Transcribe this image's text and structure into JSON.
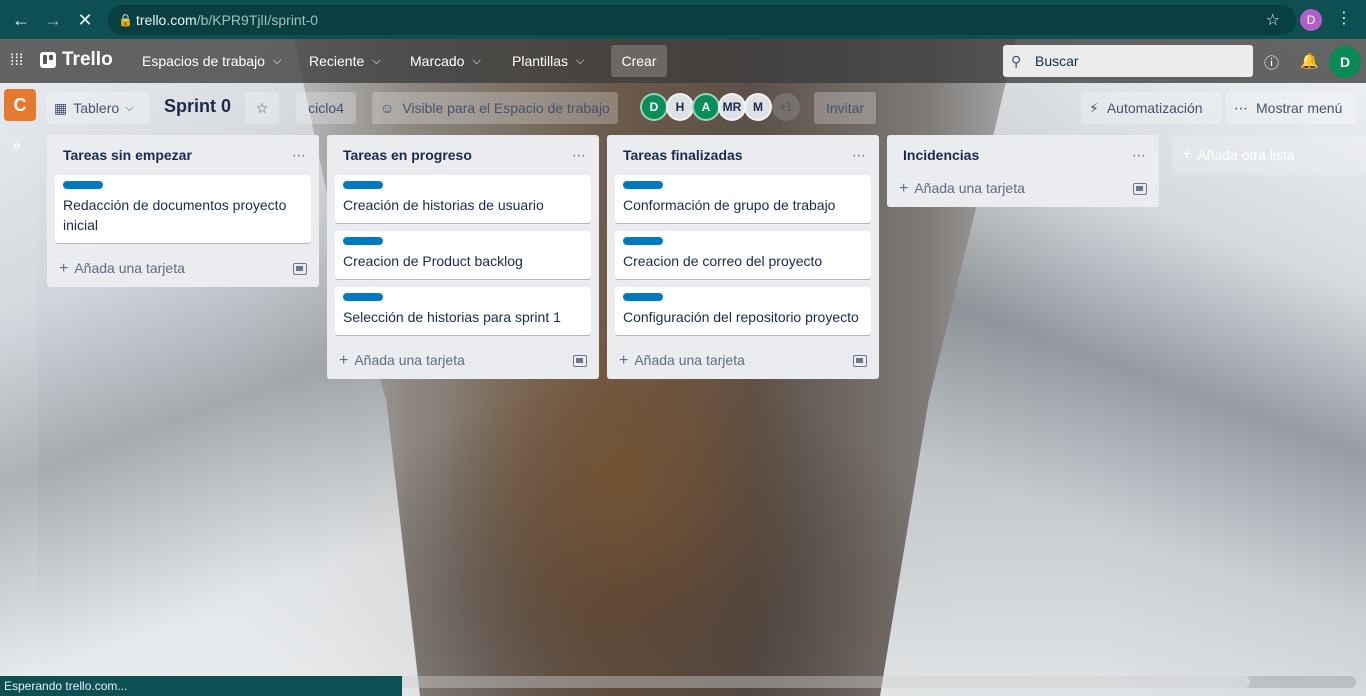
{
  "browser": {
    "back_icon": "arrow-left-icon",
    "forward_icon": "arrow-right-icon",
    "reload_icon": "close-icon",
    "url_host": "trello.com",
    "url_path": "/b/KPR9TjlI/sprint-0",
    "profile_initial": "D",
    "status_text": "Esperando trello.com..."
  },
  "header": {
    "logo_text": "Trello",
    "nav": [
      {
        "label": "Espacios de trabajo"
      },
      {
        "label": "Reciente"
      },
      {
        "label": "Marcado"
      },
      {
        "label": "Plantillas"
      }
    ],
    "create_label": "Crear",
    "search_placeholder": "Buscar",
    "user_initial": "D"
  },
  "board": {
    "workspace_initial": "C",
    "view_label": "Tablero",
    "title": "Sprint 0",
    "workspace_name": "ciclo4",
    "visibility_label": "Visible para el Espacio de trabajo",
    "members": [
      "D",
      "H",
      "A",
      "MR",
      "M"
    ],
    "members_more": "+1",
    "invite_label": "Invitar",
    "automation_label": "Automatización",
    "menu_label": "Mostrar menú",
    "add_list_label": "Añada otra lista",
    "add_card_label": "Añada una tarjeta",
    "label_color": "#0079bf"
  },
  "lists": [
    {
      "title": "Tareas sin empezar",
      "cards": [
        "Redacción de documentos proyecto inicial"
      ]
    },
    {
      "title": "Tareas en progreso",
      "cards": [
        "Creación de historias de usuario",
        "Creacion de Product backlog",
        "Selección de historias para sprint 1"
      ]
    },
    {
      "title": "Tareas finalizadas",
      "cards": [
        "Conformación de grupo de trabajo",
        "Creacion de correo del proyecto",
        "Configuración del repositorio proyecto"
      ]
    },
    {
      "title": "Incidencias",
      "cards": []
    }
  ]
}
